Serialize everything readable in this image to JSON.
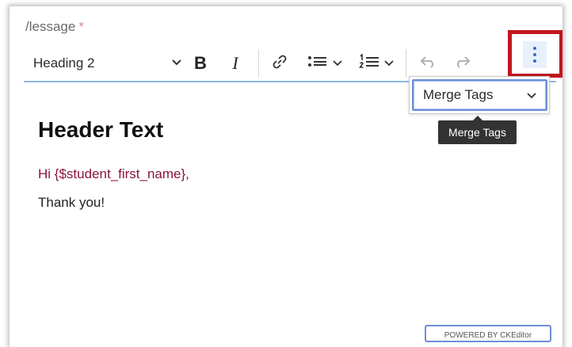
{
  "field": {
    "label": "/lessage",
    "required_mark": "*"
  },
  "toolbar": {
    "heading_value": "Heading 2",
    "bold": "B",
    "italic": "I"
  },
  "merge_tags": {
    "dropdown_value": "Merge Tags",
    "tooltip": "Merge Tags"
  },
  "editor": {
    "heading": "Header Text",
    "line1": "Hi {$student_first_name},",
    "line2": "Thank you!"
  },
  "footer": {
    "powered_by": "POWERED BY CKEditor"
  },
  "colors": {
    "highlight_border": "#c0161e",
    "accent": "#2f6ed3",
    "merge_text": "#8a1538"
  }
}
